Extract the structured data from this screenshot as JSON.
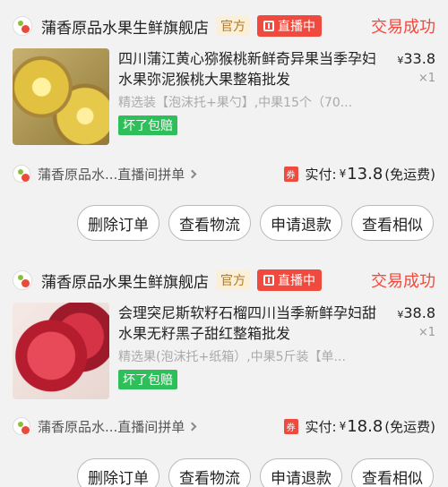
{
  "orders": [
    {
      "shop_name": "蒲香原品水果生鲜旗舰店",
      "official_badge": "官方",
      "live_badge": "直播中",
      "status": "交易成功",
      "title": "四川蒲江黄心猕猴桃新鲜奇异果当季孕妇水果弥泥猴桃大果整箱批发",
      "price_symbol": "¥",
      "price": "33.8",
      "qty": "×1",
      "spec": "精选装【泡沫托+果勺】,中果15个（70...",
      "guarantee": "坏了包赔",
      "group_text": "蒲香原品水...直播间拼单",
      "voucher": "券",
      "paid_label": "实付:",
      "paid_symbol": "¥",
      "paid_amount": "13.8",
      "paid_note": "(免运费)",
      "actions": [
        "删除订单",
        "查看物流",
        "申请退款",
        "查看相似"
      ]
    },
    {
      "shop_name": "蒲香原品水果生鲜旗舰店",
      "official_badge": "官方",
      "live_badge": "直播中",
      "status": "交易成功",
      "title": "会理突尼斯软籽石榴四川当季新鲜孕妇甜水果无籽黑子甜红整箱批发",
      "price_symbol": "¥",
      "price": "38.8",
      "qty": "×1",
      "spec": "精选果(泡沫托+纸箱）,中果5斤装【单...",
      "guarantee": "坏了包赔",
      "group_text": "蒲香原品水...直播间拼单",
      "voucher": "券",
      "paid_label": "实付:",
      "paid_symbol": "¥",
      "paid_amount": "18.8",
      "paid_note": "(免运费)",
      "actions": [
        "删除订单",
        "查看物流",
        "申请退款",
        "查看相似"
      ]
    }
  ]
}
